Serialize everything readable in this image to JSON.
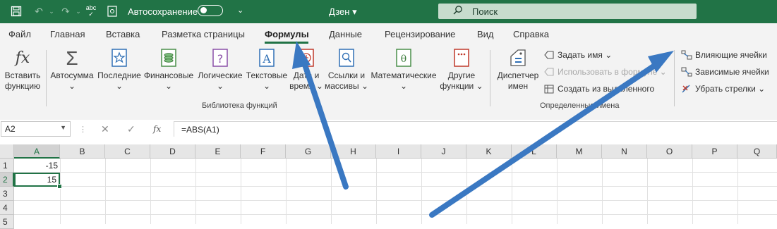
{
  "titlebar": {
    "autosave_label": "Автосохранение",
    "doc_title": "Дзен ▾",
    "search_placeholder": "Поиск",
    "spell_label": "abc"
  },
  "tabs": [
    "Файл",
    "Главная",
    "Вставка",
    "Разметка страницы",
    "Формулы",
    "Данные",
    "Рецензирование",
    "Вид",
    "Справка"
  ],
  "active_tab": "Формулы",
  "ribbon": {
    "insert_function": [
      "Вставить",
      "функцию"
    ],
    "autosum": [
      "Автосумма",
      "⌄"
    ],
    "recent": [
      "Последние",
      "⌄"
    ],
    "financial": [
      "Финансовые",
      "⌄"
    ],
    "logical": [
      "Логические",
      "⌄"
    ],
    "text": [
      "Текстовые",
      "⌄"
    ],
    "datetime": [
      "Дата и",
      "время ⌄"
    ],
    "lookup": [
      "Ссылки и",
      "массивы ⌄"
    ],
    "math": [
      "Математические",
      "⌄"
    ],
    "other": [
      "Другие",
      "функции ⌄"
    ],
    "library_group": "Библиотека функций",
    "name_manager": [
      "Диспетчер",
      "имен"
    ],
    "define_name": "Задать имя ⌄",
    "use_in_formula": "Использовать в формуле ⌄",
    "create_from_selection": "Создать из выделенного",
    "names_group": "Определенные имена",
    "trace_precedents": "Влияющие ячейки",
    "trace_dependents": "Зависимые ячейки",
    "remove_arrows": "Убрать стрелки ⌄"
  },
  "formula_bar": {
    "name_box": "A2",
    "formula": "=ABS(A1)",
    "fx": "fx"
  },
  "sheet": {
    "columns": [
      "A",
      "B",
      "C",
      "D",
      "E",
      "F",
      "G",
      "H",
      "I",
      "J",
      "K",
      "L",
      "M",
      "N",
      "O",
      "P",
      "Q"
    ],
    "rows": [
      "1",
      "2",
      "3",
      "4",
      "5"
    ],
    "cells": {
      "A1": "-15",
      "A2": "15"
    },
    "active_cell": "A2"
  },
  "colors": {
    "accent": "#217346",
    "arrow": "#3a78c2"
  }
}
